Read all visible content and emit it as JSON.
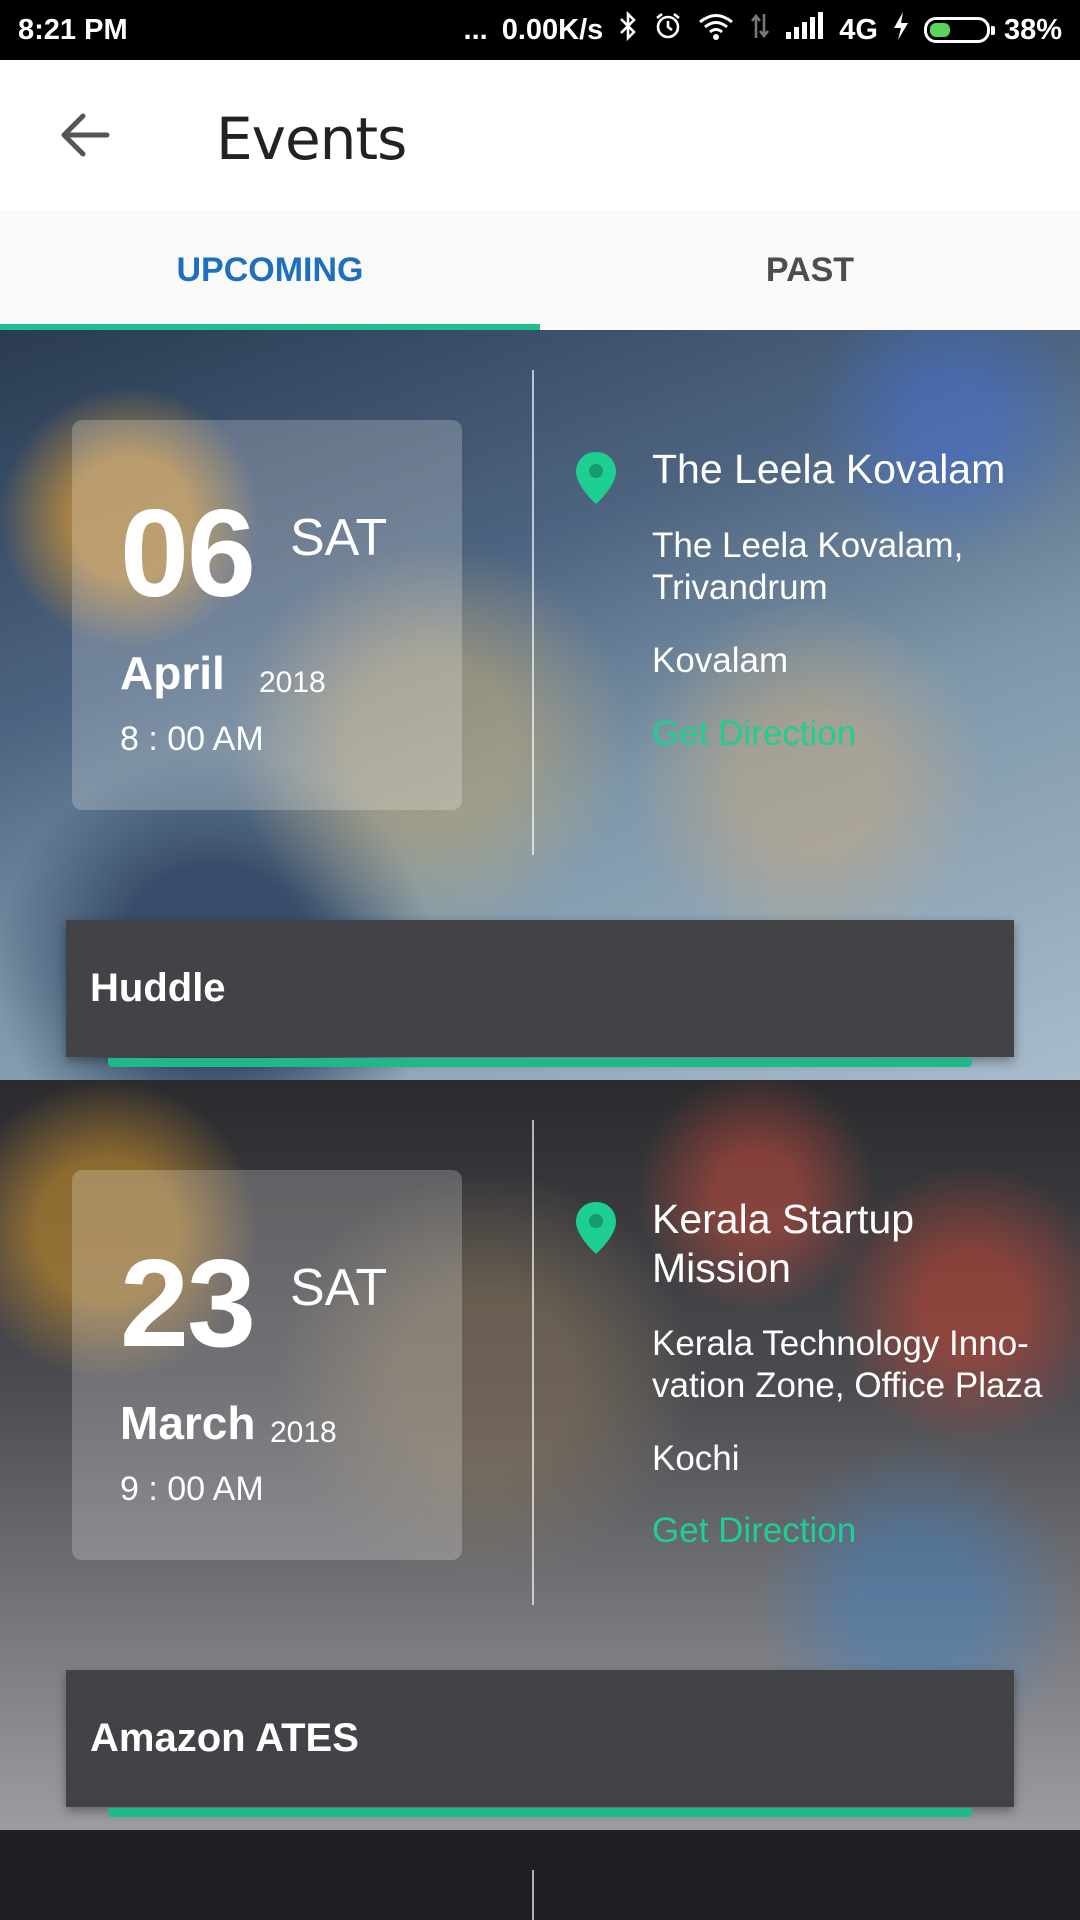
{
  "status_bar": {
    "time": "8:21 PM",
    "dots": "...",
    "speed": "0.00K/s",
    "network": "4G",
    "battery": "38%",
    "battery_level": 0.38
  },
  "header": {
    "title": "Events",
    "back_icon": "arrow-left-icon"
  },
  "tabs": [
    {
      "label": "UPCOMING",
      "active": true
    },
    {
      "label": "PAST",
      "active": false
    }
  ],
  "events": [
    {
      "day": "06",
      "weekday": "SAT",
      "month": "April",
      "year": "2018",
      "time": "8 : 00 AM",
      "venue": "The Leela Kovalam",
      "address": "The Leela Kovalam, Trivandrum",
      "city": "Kovalam",
      "direction_label": "Get Direction",
      "title": "Huddle"
    },
    {
      "day": "23",
      "weekday": "SAT",
      "month": "March",
      "year": "2018",
      "time": "9 : 00 AM",
      "venue": "Kerala Startup Mission",
      "address": "Kerala Technology Inno-vation Zone, Office Plaza",
      "city": "Kochi",
      "direction_label": "Get Direction",
      "title": "Amazon ATES"
    }
  ],
  "colors": {
    "accent_green": "#1ecf92",
    "active_tab_blue": "#1f6fc1",
    "title_bar": "#424347"
  }
}
